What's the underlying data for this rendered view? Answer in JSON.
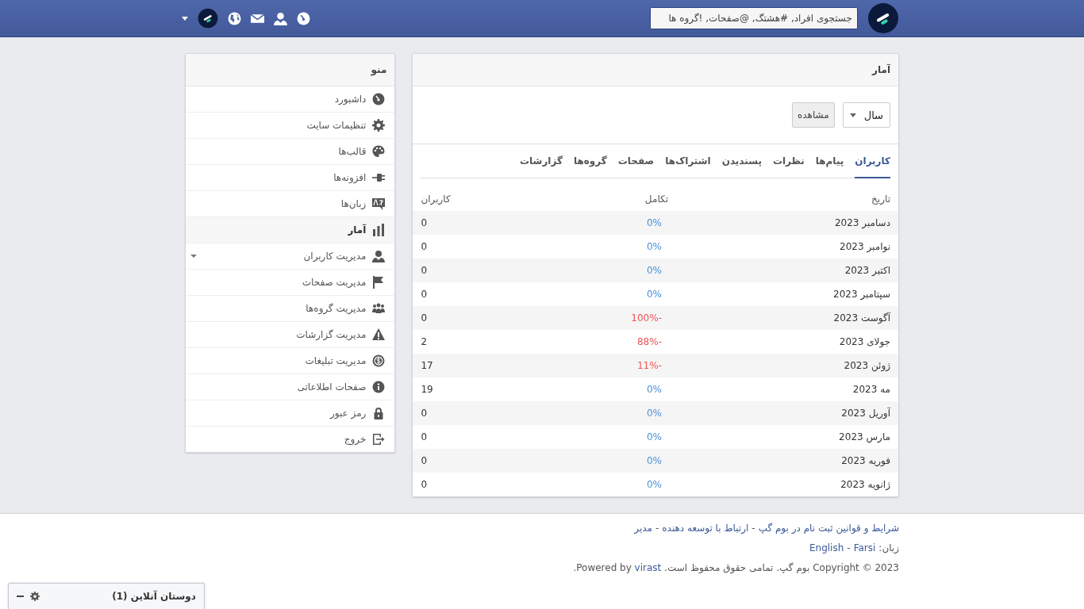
{
  "header": {
    "search": {
      "placeholder": "جستجوی افراد, #هشتگ, @صفحات, !گروه ها"
    }
  },
  "menu": {
    "title": "منو",
    "items": [
      {
        "label": "داشبورد",
        "selected": false,
        "has_submenu": false
      },
      {
        "label": "تنظیمات سایت",
        "selected": false,
        "has_submenu": false
      },
      {
        "label": "قالب‌ها",
        "selected": false,
        "has_submenu": false
      },
      {
        "label": "افزونه‌ها",
        "selected": false,
        "has_submenu": false
      },
      {
        "label": "زبان‌ها",
        "selected": false,
        "has_submenu": false
      },
      {
        "label": "آمار",
        "selected": true,
        "has_submenu": false
      },
      {
        "label": "مدیریت کاربران",
        "selected": false,
        "has_submenu": true
      },
      {
        "label": "مدیریت صفحات",
        "selected": false,
        "has_submenu": false
      },
      {
        "label": "مدیریت گروه‌ها",
        "selected": false,
        "has_submenu": false
      },
      {
        "label": "مدیریت گزارشات",
        "selected": false,
        "has_submenu": false
      },
      {
        "label": "مدیریت تبلیغات",
        "selected": false,
        "has_submenu": false
      },
      {
        "label": "صفحات اطلاعاتی",
        "selected": false,
        "has_submenu": false
      },
      {
        "label": "رمز عبور",
        "selected": false,
        "has_submenu": false
      },
      {
        "label": "خروج",
        "selected": false,
        "has_submenu": false
      }
    ]
  },
  "stats": {
    "title": "آمار",
    "period_select": {
      "value": "سال"
    },
    "view_button": "مشاهده",
    "tabs": [
      {
        "label": "کاربران",
        "selected": true
      },
      {
        "label": "پیام‌ها",
        "selected": false
      },
      {
        "label": "نظرات",
        "selected": false
      },
      {
        "label": "پسندیدن",
        "selected": false
      },
      {
        "label": "اشتراک‌ها",
        "selected": false
      },
      {
        "label": "صفحات",
        "selected": false
      },
      {
        "label": "گروه‌ها",
        "selected": false
      },
      {
        "label": "گزارشات",
        "selected": false
      }
    ],
    "table": {
      "columns": [
        "تاریخ",
        "تکامل",
        "کاربران"
      ],
      "rows": [
        {
          "date": "دسامبر 2023",
          "growth": "0%",
          "negative": false,
          "users": "0"
        },
        {
          "date": "نوامبر 2023",
          "growth": "0%",
          "negative": false,
          "users": "0"
        },
        {
          "date": "اکتبر 2023",
          "growth": "0%",
          "negative": false,
          "users": "0"
        },
        {
          "date": "سپتامبر 2023",
          "growth": "0%",
          "negative": false,
          "users": "0"
        },
        {
          "date": "آگوست 2023",
          "growth": "-100%",
          "negative": true,
          "users": "0"
        },
        {
          "date": "جولای 2023",
          "growth": "-88%",
          "negative": true,
          "users": "2"
        },
        {
          "date": "ژوئن 2023",
          "growth": "-11%",
          "negative": true,
          "users": "17"
        },
        {
          "date": "مه 2023",
          "growth": "0%",
          "negative": false,
          "users": "19"
        },
        {
          "date": "آوریل 2023",
          "growth": "0%",
          "negative": false,
          "users": "0"
        },
        {
          "date": "مارس 2023",
          "growth": "0%",
          "negative": false,
          "users": "0"
        },
        {
          "date": "فوریه 2023",
          "growth": "0%",
          "negative": false,
          "users": "0"
        },
        {
          "date": "ژانویه 2023",
          "growth": "0%",
          "negative": false,
          "users": "0"
        }
      ]
    }
  },
  "footer": {
    "separator": "-",
    "copyright_end": ".",
    "links": [
      "شرایط و قوانین ثبت نام در بوم گپ",
      "ارتباط با توسعه دهنده",
      "مدیر"
    ],
    "language_label": "زبان:",
    "languages": [
      "Farsi",
      "English"
    ],
    "copyright": "2023 © Copyright بوم گپ. تمامی حقوق محفوظ است. Powered by",
    "powered_link": "virast"
  },
  "chat_bar": {
    "title": "دوستان آنلاین (1)"
  }
}
